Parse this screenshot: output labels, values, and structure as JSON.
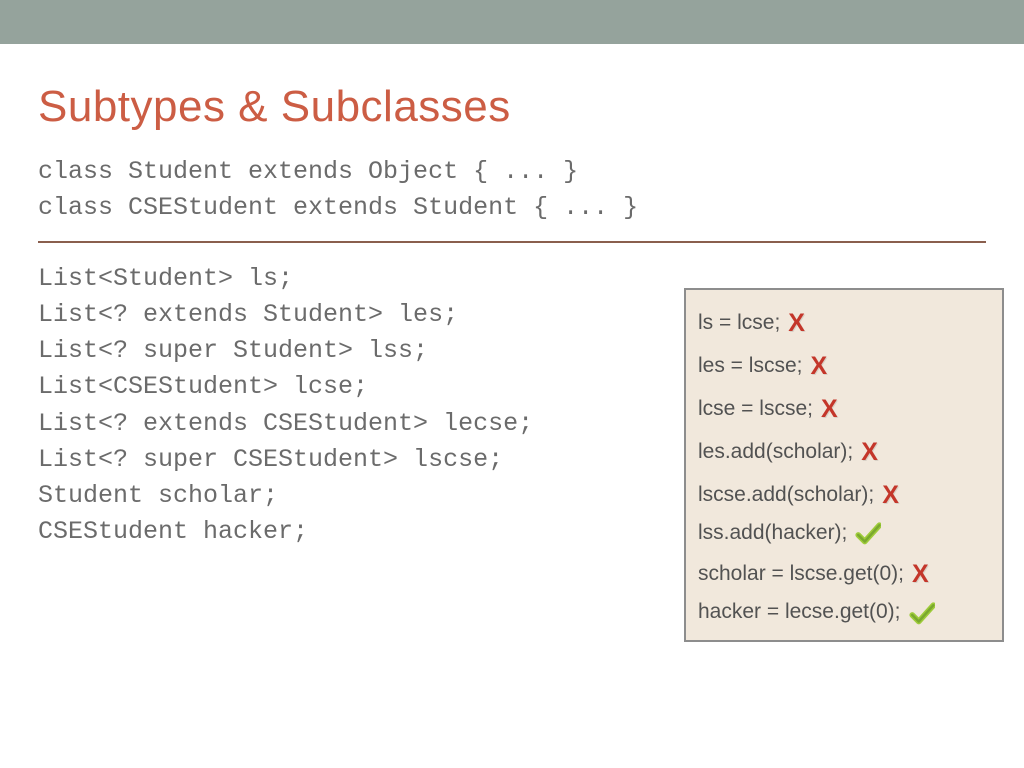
{
  "title": "Subtypes & Subclasses",
  "classDefs": [
    "class Student extends Object { ... }",
    "class CSEStudent extends Student { ... }"
  ],
  "declarations": [
    "List<Student> ls;",
    "List<? extends Student> les;",
    "List<? super Student> lss;",
    "List<CSEStudent> lcse;",
    "List<? extends CSEStudent> lecse;",
    "List<? super CSEStudent> lscse;",
    "Student scholar;",
    "CSEStudent hacker;"
  ],
  "callout": [
    {
      "text": "ls = lcse;",
      "mark": "x"
    },
    {
      "text": "les = lscse;",
      "mark": "x"
    },
    {
      "text": "lcse = lscse;",
      "mark": "x"
    },
    {
      "text": "les.add(scholar);",
      "mark": "x"
    },
    {
      "text": "lscse.add(scholar);",
      "mark": "x"
    },
    {
      "text": "lss.add(hacker);",
      "mark": "check"
    },
    {
      "text": "scholar = lscse.get(0);",
      "mark": "x"
    },
    {
      "text": "hacker = lecse.get(0);",
      "mark": "check"
    }
  ],
  "marks": {
    "x": "X"
  }
}
